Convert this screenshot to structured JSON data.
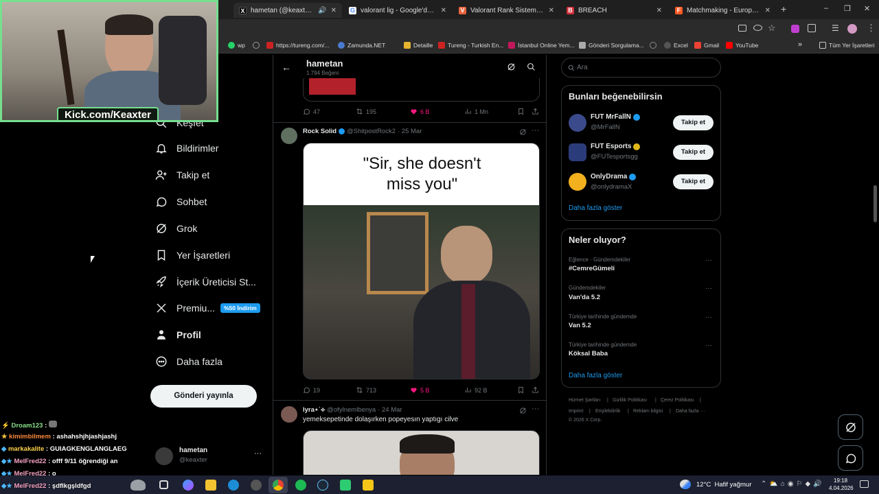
{
  "browser": {
    "tabs": [
      {
        "title": "hametan (@keaxter) adlı kullanıcı",
        "color": "#1d1d1d",
        "glyph": "X"
      },
      {
        "title": "valorant lig - Google'da Ara",
        "color": "#4285f4",
        "glyph": "G"
      },
      {
        "title": "Valorant Rank Sistemi ve Kademe",
        "color": "#e8623c",
        "glyph": "V"
      },
      {
        "title": "BREACH",
        "color": "#d2313c",
        "glyph": "B"
      },
      {
        "title": "Matchmaking - Europe 5v5 Quick",
        "color": "#ff5a24",
        "glyph": "F"
      }
    ],
    "new_tab": "+",
    "window_controls": {
      "minimize": "–",
      "maximize": "❐",
      "close": "✕"
    },
    "bookmarks": [
      {
        "label": "wp",
        "color": "#25d366"
      },
      {
        "label": "",
        "color": "#999"
      },
      {
        "label": "https://tureng.com/...",
        "color": "#c22"
      },
      {
        "label": "Zamunda.NET",
        "color": "#4a7bd0"
      },
      {
        "label": "Detaille",
        "color": "#e6b32e"
      },
      {
        "label": "Tureng - Turkish En...",
        "color": "#c22"
      },
      {
        "label": "İstanbul Online Yem...",
        "color": "#c2185b"
      },
      {
        "label": "Gönderi Sorgulama...",
        "color": "#aaa"
      },
      {
        "label": "",
        "color": "#888"
      },
      {
        "label": "Excel",
        "color": "#888"
      },
      {
        "label": "Gmail",
        "color": "#ea4335"
      },
      {
        "label": "YouTube",
        "color": "#ff0000"
      }
    ],
    "bookmarks_more": "»",
    "all_bookmarks": "Tüm Yer İşaretleri"
  },
  "webcam": {
    "label": "Kick.com/Keaxter"
  },
  "nav": {
    "items": [
      {
        "label": "Keşfet",
        "icon": "search-icon"
      },
      {
        "label": "Bildirimler",
        "icon": "bell-icon"
      },
      {
        "label": "Takip et",
        "icon": "add-person-icon"
      },
      {
        "label": "Sohbet",
        "icon": "chat-icon"
      },
      {
        "label": "Grok",
        "icon": "grok-icon"
      },
      {
        "label": "Yer İşaretleri",
        "icon": "bookmark-icon"
      },
      {
        "label": "İçerik Üreticisi St...",
        "icon": "rocket-icon"
      },
      {
        "label": "Premiu...",
        "icon": "x-logo-icon"
      },
      {
        "label": "Profil",
        "icon": "person-icon"
      },
      {
        "label": "Daha fazla",
        "icon": "more-circle-icon"
      }
    ],
    "premium_badge": "%50 İndirim",
    "post_button": "Gönderi yayınla",
    "account": {
      "name": "hametan",
      "handle": "@keaxter",
      "more": "···"
    }
  },
  "header": {
    "title": "hametan",
    "subtitle": "1.794 Beğeni"
  },
  "tweets": [
    {
      "stats": {
        "replies": "47",
        "reposts": "195",
        "likes": "6 B",
        "views": "1 Mn"
      }
    },
    {
      "author": "Rock Solid",
      "handle": "@ShitpostRock2",
      "date": "· 25 Mar",
      "image_caption": "\"Sir, she doesn't miss you\"",
      "stats": {
        "replies": "19",
        "reposts": "713",
        "likes": "5 B",
        "views": "92 B"
      }
    },
    {
      "author": "lyra⋆˙⟡",
      "handle": "@ofylnemlbenya",
      "date": "· 24 Mar",
      "text": "yemeksepetinde dolaşırken popeyesın yaptıgı cilve"
    }
  ],
  "search": {
    "placeholder": "Ara"
  },
  "suggestions": {
    "title": "Bunları beğenebilirsin",
    "users": [
      {
        "name": "FUT MrFallN",
        "handle": "@MrFallN",
        "badge": "#1d9bf0",
        "avatar": "#3b4a8a"
      },
      {
        "name": "FUT Esports",
        "handle": "@FUTesportsgg",
        "badge": "#e2b719",
        "avatar": "#2b3c7a"
      },
      {
        "name": "OnlyDrama",
        "handle": "@onlydramaX",
        "badge": "#1d9bf0",
        "avatar": "#f2b01e"
      }
    ],
    "follow_label": "Takip et",
    "show_more": "Daha fazla göster"
  },
  "trends": {
    "title": "Neler oluyor?",
    "items": [
      {
        "meta": "Eğlence · Gündemdekiler",
        "title": "#CemreGümeli"
      },
      {
        "meta": "Gündemdekiler",
        "title": "Van'da 5.2"
      },
      {
        "meta": "Türkiye tarihinde gündemde",
        "title": "Van 5.2"
      },
      {
        "meta": "Türkiye tarihinde gündemde",
        "title": "Köksal Baba"
      }
    ],
    "more": "···",
    "show_more": "Daha fazla göster"
  },
  "footer": {
    "links": [
      "Hizmet Şartları",
      "Gizlilik Politikası",
      "Çerez Politikası",
      "Imprint",
      "Erişilebilirlik",
      "Reklam bilgisi",
      "Daha fazla ···"
    ],
    "copyright": "© 2026 X Corp."
  },
  "chat": [
    {
      "user": "Droam123",
      "msg": "",
      "color": "#8be28b"
    },
    {
      "user": "kimimbilmem",
      "msg": "ashahshjhjashjashj",
      "color": "#ff8b3d"
    },
    {
      "user": "markakalite",
      "msg": "GUIAGKENGLANGLAEG",
      "color": "#ffd24c"
    },
    {
      "user": "MelFred22",
      "msg": "offf 9/11 öğrendiği an",
      "color": "#f6a3c4"
    },
    {
      "user": "MelFred22",
      "msg": "o",
      "color": "#f6a3c4"
    },
    {
      "user": "MelFred22",
      "msg": "şdflkgşldfgd",
      "color": "#f6a3c4"
    }
  ],
  "taskbar": {
    "weather": "12°C  Hafif yağmur",
    "time": "19:18",
    "date": "4.04.2026"
  }
}
